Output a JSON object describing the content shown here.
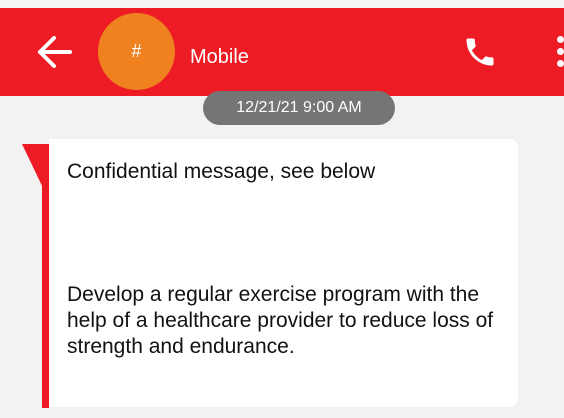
{
  "header": {
    "avatar_symbol": "#",
    "contact_name": "Mobile",
    "back_icon": "arrow-left-icon",
    "call_icon": "phone-icon",
    "menu_icon": "more-vertical-icon",
    "color_bar": "#ed1c24",
    "color_avatar": "#f0811f"
  },
  "conversation": {
    "timestamp": "12/21/21 9:00 AM",
    "messages": [
      {
        "line1": "Confidential message, see below",
        "body": "Develop a regular exercise program with the help of a healthcare provider to reduce loss of strength and endurance."
      }
    ]
  }
}
